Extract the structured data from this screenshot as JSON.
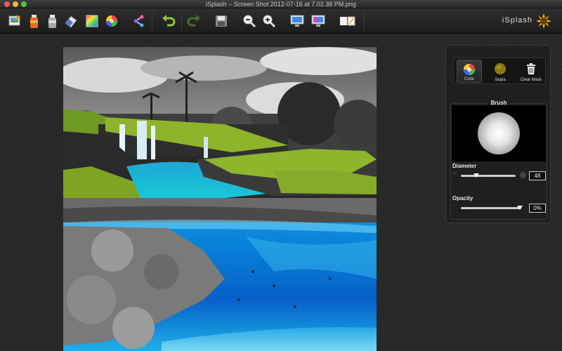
{
  "window": {
    "title": "iSplash – Screen Shot 2012-07-16 at 7.02.38 PM.png",
    "traffic_colors": [
      "#ee5a52",
      "#f3b92d",
      "#5bc23f"
    ]
  },
  "toolbar": {
    "icons": [
      "open-image-icon",
      "spray-can-icon",
      "silver-spray-can-icon",
      "eraser-icon",
      "color-grid-icon",
      "color-wheel-icon",
      "share-icon",
      "undo-icon",
      "redo-icon",
      "save-icon",
      "zoom-out-icon",
      "zoom-in-icon",
      "monitor-icon",
      "compare-icon",
      "split-view-icon"
    ],
    "brand": "iSplash"
  },
  "panel": {
    "modes": [
      {
        "label": "Color",
        "icon": "color-wheel-icon",
        "active": true
      },
      {
        "label": "Sepia",
        "icon": "sepia-disc-icon",
        "active": false
      },
      {
        "label": "Clear Mask",
        "icon": "trash-icon",
        "active": false
      }
    ],
    "brush": {
      "title": "Brush",
      "diameter_label": "Diameter",
      "diameter_value": "48",
      "diameter_level": 0.28,
      "opacity_label": "Opacity",
      "opacity_value": "0%",
      "opacity_level": 0.98
    }
  },
  "colors": {
    "accent_water": "#1fb8e6",
    "moss": "#9bc42e",
    "sepia": "#8a7a14"
  }
}
